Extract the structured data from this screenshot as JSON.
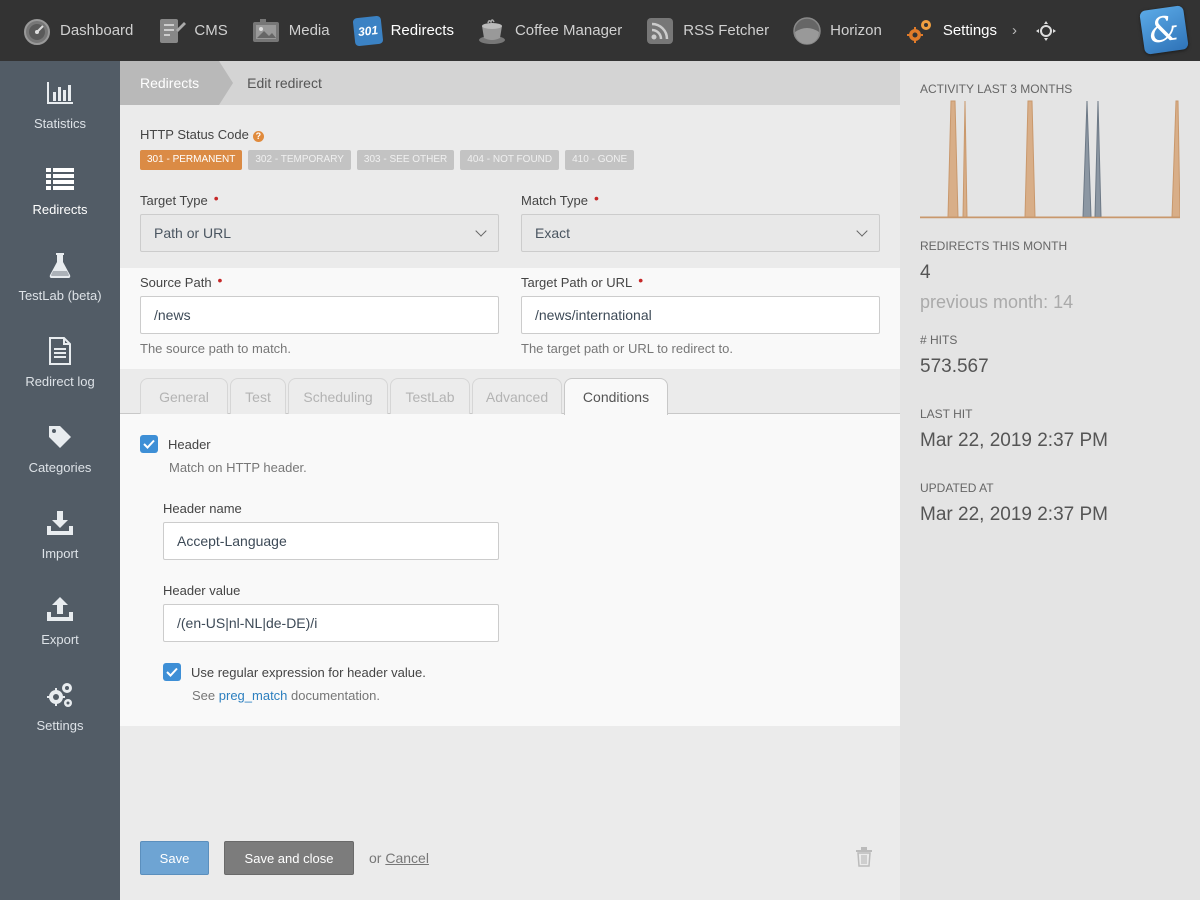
{
  "topnav": {
    "items": [
      {
        "label": "Dashboard",
        "icon": "speedometer-icon"
      },
      {
        "label": "CMS",
        "icon": "cms-icon"
      },
      {
        "label": "Media",
        "icon": "media-icon"
      },
      {
        "label": "Redirects",
        "icon": "redirects-301-icon",
        "badge": "301"
      },
      {
        "label": "Coffee Manager",
        "icon": "coffee-icon"
      },
      {
        "label": "RSS Fetcher",
        "icon": "rss-icon"
      },
      {
        "label": "Horizon",
        "icon": "horizon-icon"
      },
      {
        "label": "Settings",
        "icon": "gears-icon"
      }
    ],
    "more": "›",
    "logo_glyph": "&"
  },
  "sidebar": {
    "items": [
      {
        "label": "Statistics",
        "icon": "bar-chart-icon"
      },
      {
        "label": "Redirects",
        "icon": "list-icon",
        "active": true
      },
      {
        "label": "TestLab (beta)",
        "icon": "flask-icon"
      },
      {
        "label": "Redirect log",
        "icon": "document-icon"
      },
      {
        "label": "Categories",
        "icon": "tag-icon"
      },
      {
        "label": "Import",
        "icon": "download-icon"
      },
      {
        "label": "Export",
        "icon": "upload-icon"
      },
      {
        "label": "Settings",
        "icon": "gears-icon"
      }
    ]
  },
  "breadcrumb": {
    "first": "Redirects",
    "second": "Edit redirect"
  },
  "form": {
    "status_code_label": "HTTP Status Code",
    "help_glyph": "?",
    "status_options": [
      {
        "label": "301 - PERMANENT",
        "active": true
      },
      {
        "label": "302 - TEMPORARY",
        "active": false
      },
      {
        "label": "303 - SEE OTHER",
        "active": false
      },
      {
        "label": "404 - NOT FOUND",
        "active": false
      },
      {
        "label": "410 - GONE",
        "active": false
      }
    ],
    "target_type_label": "Target Type",
    "target_type_value": "Path or URL",
    "match_type_label": "Match Type",
    "match_type_value": "Exact",
    "source_path_label": "Source Path",
    "source_path_value": "/news",
    "source_path_hint": "The source path to match.",
    "target_path_label": "Target Path or URL",
    "target_path_value": "/news/international",
    "target_path_hint": "The target path or URL to redirect to.",
    "required_mark": "•"
  },
  "tabs": [
    {
      "label": "General",
      "active": false
    },
    {
      "label": "Test",
      "active": false
    },
    {
      "label": "Scheduling",
      "active": false
    },
    {
      "label": "TestLab",
      "active": false
    },
    {
      "label": "Advanced",
      "active": false
    },
    {
      "label": "Conditions",
      "active": true
    }
  ],
  "conditions": {
    "header_checkbox_label": "Header",
    "header_checked": true,
    "header_hint": "Match on HTTP header.",
    "header_name_label": "Header name",
    "header_name_value": "Accept-Language",
    "header_value_label": "Header value",
    "header_value_value": "/(en-US|nl-NL|de-DE)/i",
    "regex_checkbox_label": "Use regular expression for header value.",
    "regex_checked": true,
    "regex_hint_prefix": "See",
    "regex_hint_link": "preg_match",
    "regex_hint_suffix": "documentation."
  },
  "actions": {
    "save": "Save",
    "save_and_close": "Save and close",
    "or": "or",
    "cancel": "Cancel"
  },
  "stats": {
    "activity_label": "ACTIVITY LAST 3 MONTHS",
    "redirects_month_label": "REDIRECTS THIS MONTH",
    "redirects_month_value": "4",
    "previous_month": "previous month: 14",
    "hits_label": "# HITS",
    "hits_value": "573.567",
    "last_hit_label": "LAST HIT",
    "last_hit_value": "Mar 22, 2019 2:37 PM",
    "updated_label": "UPDATED AT",
    "updated_value": "Mar 22, 2019 2:37 PM"
  },
  "colors": {
    "accent_orange": "#db8b45",
    "accent_blue": "#3e8fd6",
    "sidebar_bg": "#525c66",
    "topbar_bg": "#333333",
    "spark_orange": "#d9b08c",
    "spark_blue": "#8896a6"
  }
}
